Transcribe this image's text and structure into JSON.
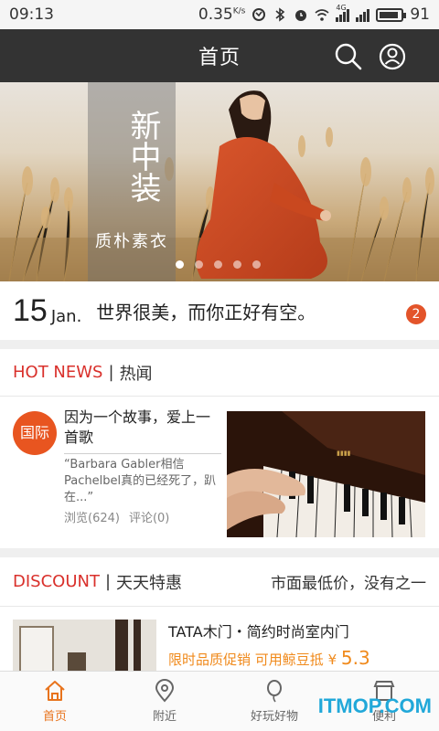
{
  "status_bar": {
    "time": "09:13",
    "speed": "0.35",
    "speed_unit": "K/s",
    "network": "4G",
    "battery": "91",
    "battery_level": 0.91
  },
  "header": {
    "title": "首页",
    "search_icon": "search-icon",
    "user_icon": "user-icon"
  },
  "banner": {
    "calligraphy_title": "新中装",
    "calligraphy_subtitle": "质朴素衣",
    "slide_count": 5,
    "active_slide": 0
  },
  "daily": {
    "day": "15",
    "month": "Jan.",
    "quote": "世界很美，而你正好有空。",
    "badge": "2"
  },
  "hot_news": {
    "title_en": "HOT NEWS",
    "separator": "|",
    "title_cn": "热闻",
    "item": {
      "category": "国际",
      "headline": "因为一个故事，爱上一首歌",
      "excerpt": "“Barbara Gabler相信Pachelbel真的已经死了，趴在...”",
      "views": "浏览(624)",
      "comments": "评论(0)"
    }
  },
  "discount": {
    "title_en": "DISCOUNT",
    "separator": "|",
    "title_cn": "天天特惠",
    "aside": "市面最低价，没有之一",
    "item": {
      "name": "TATA木门・简约时尚室内门",
      "promo": "限时品质促销 可用鲸豆抵",
      "currency": "¥",
      "price": "5.3"
    }
  },
  "tabbar": {
    "tabs": [
      {
        "label": "首页",
        "icon": "home-icon",
        "active": true
      },
      {
        "label": "附近",
        "icon": "location-pin-icon",
        "active": false
      },
      {
        "label": "好玩好物",
        "icon": "balloon-icon",
        "active": false
      },
      {
        "label": "便利",
        "icon": "shop-icon",
        "active": false
      }
    ]
  },
  "watermark": "ITMOP.COM",
  "colors": {
    "header_bg": "#333333",
    "accent_red": "#d9302b",
    "accent_orange": "#e8731c",
    "price_orange": "#f08a1c",
    "badge_red": "#e3542a"
  }
}
